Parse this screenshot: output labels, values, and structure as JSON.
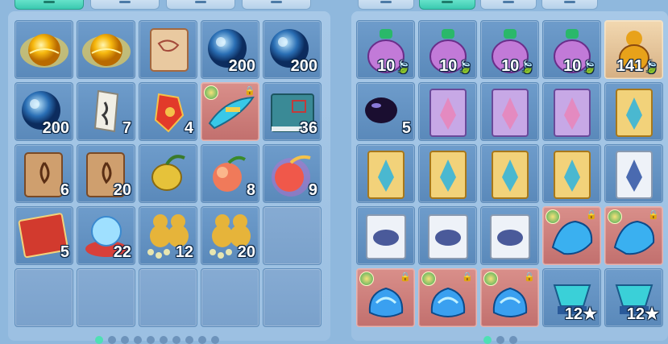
{
  "left_inventory": {
    "items": [
      {
        "name": "gold-orb",
        "qty": "",
        "bg": "blue"
      },
      {
        "name": "gold-orb",
        "qty": "",
        "bg": "blue"
      },
      {
        "name": "map-scroll",
        "qty": "",
        "bg": "blue"
      },
      {
        "name": "blue-orb",
        "qty": "200",
        "bg": "blue"
      },
      {
        "name": "blue-orb",
        "qty": "200",
        "bg": "blue"
      },
      {
        "name": "blue-orb",
        "qty": "200",
        "bg": "blue"
      },
      {
        "name": "rune-talisman",
        "qty": "7",
        "bg": "blue"
      },
      {
        "name": "red-charm",
        "qty": "4",
        "bg": "blue"
      },
      {
        "name": "flying-sword-mount",
        "qty": "",
        "bg": "red",
        "locked": true,
        "badge": true
      },
      {
        "name": "blue-book",
        "qty": "36",
        "bg": "blue"
      },
      {
        "name": "fire-scroll",
        "qty": "6",
        "bg": "blue"
      },
      {
        "name": "fire-scroll",
        "qty": "20",
        "bg": "blue"
      },
      {
        "name": "golden-fruit",
        "qty": "",
        "bg": "blue"
      },
      {
        "name": "peach",
        "qty": "8",
        "bg": "blue"
      },
      {
        "name": "glowing-peach",
        "qty": "9",
        "bg": "blue"
      },
      {
        "name": "red-book",
        "qty": "5",
        "bg": "blue"
      },
      {
        "name": "crystal-ball",
        "qty": "22",
        "bg": "blue"
      },
      {
        "name": "gourd-pills",
        "qty": "12",
        "bg": "blue"
      },
      {
        "name": "gourd-pills",
        "qty": "20",
        "bg": "blue"
      },
      {
        "name": "empty",
        "qty": "",
        "bg": "empty"
      },
      {
        "name": "empty",
        "qty": "",
        "bg": "empty"
      },
      {
        "name": "empty",
        "qty": "",
        "bg": "empty"
      },
      {
        "name": "empty",
        "qty": "",
        "bg": "empty"
      },
      {
        "name": "empty",
        "qty": "",
        "bg": "empty"
      },
      {
        "name": "empty",
        "qty": "",
        "bg": "empty"
      }
    ],
    "page_dots": 10,
    "active_dot": 0
  },
  "right_inventory": {
    "items": [
      {
        "name": "purple-vase",
        "qty": "10",
        "leaf": true,
        "bg": "blue"
      },
      {
        "name": "purple-vase",
        "qty": "10",
        "leaf": true,
        "bg": "blue"
      },
      {
        "name": "purple-vase",
        "qty": "10",
        "leaf": true,
        "bg": "blue"
      },
      {
        "name": "purple-vase",
        "qty": "10",
        "leaf": true,
        "bg": "blue"
      },
      {
        "name": "gold-gourd",
        "qty": "141",
        "leaf": true,
        "bg": "tan"
      },
      {
        "name": "dark-bead",
        "qty": "5",
        "bg": "blue"
      },
      {
        "name": "purple-card",
        "qty": "",
        "bg": "blue"
      },
      {
        "name": "purple-card",
        "qty": "",
        "bg": "blue"
      },
      {
        "name": "purple-card",
        "qty": "",
        "bg": "blue"
      },
      {
        "name": "gold-card",
        "qty": "",
        "bg": "blue"
      },
      {
        "name": "gold-card",
        "qty": "",
        "bg": "blue"
      },
      {
        "name": "gold-card",
        "qty": "",
        "bg": "blue"
      },
      {
        "name": "gold-card",
        "qty": "",
        "bg": "blue"
      },
      {
        "name": "gold-card",
        "qty": "",
        "bg": "blue"
      },
      {
        "name": "white-card",
        "qty": "",
        "bg": "blue"
      },
      {
        "name": "white-beast-card",
        "qty": "",
        "bg": "blue"
      },
      {
        "name": "white-beast-card",
        "qty": "",
        "bg": "blue"
      },
      {
        "name": "white-beast-card",
        "qty": "",
        "bg": "blue"
      },
      {
        "name": "blue-phoenix",
        "qty": "",
        "bg": "red",
        "locked": true,
        "badge": true
      },
      {
        "name": "blue-phoenix",
        "qty": "",
        "bg": "red",
        "locked": true,
        "badge": true
      },
      {
        "name": "blue-fox",
        "qty": "",
        "bg": "red",
        "locked": true,
        "badge": true
      },
      {
        "name": "blue-fox",
        "qty": "",
        "bg": "red",
        "locked": true,
        "badge": true
      },
      {
        "name": "blue-fox",
        "qty": "",
        "bg": "red",
        "locked": true,
        "badge": true
      },
      {
        "name": "cyan-gem",
        "qty": "12",
        "star": true,
        "bg": "blue"
      },
      {
        "name": "cyan-gem",
        "qty": "12",
        "star": true,
        "bg": "blue"
      }
    ],
    "page_dots": 3,
    "active_dot": 0
  },
  "glyphs": {
    "leaf": "🍃",
    "star": "★",
    "lock": "🔒"
  }
}
